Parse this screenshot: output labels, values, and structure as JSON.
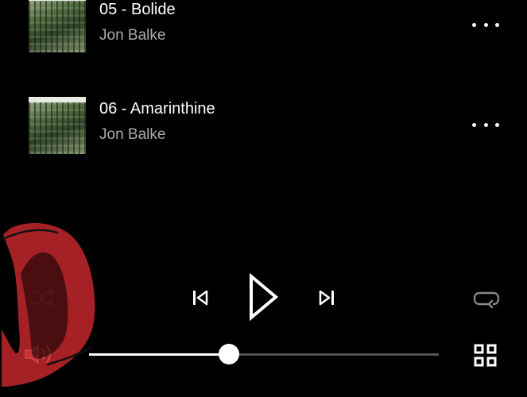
{
  "tracks": [
    {
      "title": "05 - Bolide",
      "artist": "Jon Balke"
    },
    {
      "title": "06 - Amarinthine",
      "artist": "Jon Balke"
    }
  ],
  "player": {
    "progress_fraction": 0.4,
    "icons": {
      "shuffle": "shuffle-icon",
      "previous": "skip-previous-icon",
      "play": "play-icon",
      "next": "skip-next-icon",
      "repeat": "repeat-icon",
      "volume": "volume-icon",
      "queue": "grid-icon",
      "more": "more-options-icon"
    }
  },
  "colors": {
    "background": "#000000",
    "primary_text": "#ffffff",
    "secondary_text": "#a9a9a9",
    "annotation_red": "#c2272d"
  }
}
